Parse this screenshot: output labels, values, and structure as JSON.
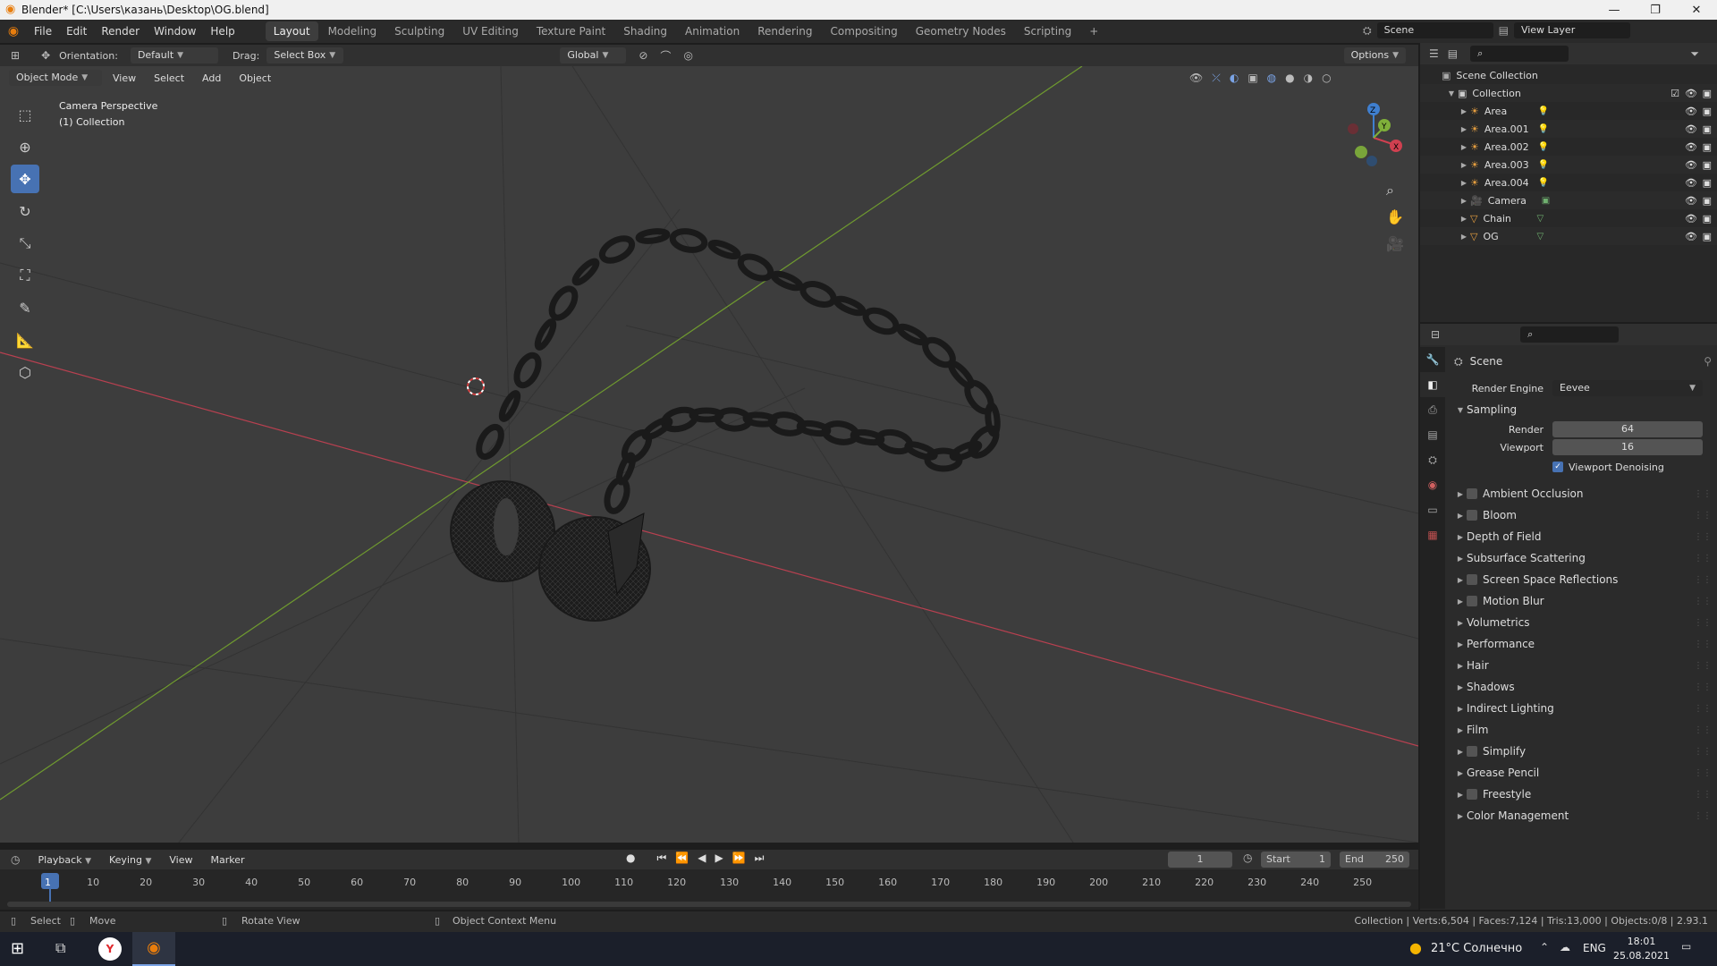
{
  "window": {
    "title": "Blender* [C:\\Users\\казань\\Desktop\\OG.blend]"
  },
  "menu": [
    "File",
    "Edit",
    "Render",
    "Window",
    "Help"
  ],
  "workspaces": [
    "Layout",
    "Modeling",
    "Sculpting",
    "UV Editing",
    "Texture Paint",
    "Shading",
    "Animation",
    "Rendering",
    "Compositing",
    "Geometry Nodes",
    "Scripting",
    "+"
  ],
  "scene_name": "Scene",
  "view_layer": "View Layer",
  "header": {
    "orientation_label": "Orientation:",
    "orientation_value": "Default",
    "drag_label": "Drag:",
    "drag_value": "Select Box",
    "transform_space": "Global",
    "options": "Options"
  },
  "viewport_header": {
    "mode": "Object Mode",
    "view": "View",
    "select": "Select",
    "add": "Add",
    "object": "Object"
  },
  "viewport": {
    "camera_label": "Camera Perspective",
    "collection_label": "(1) Collection"
  },
  "outliner": {
    "root": "Scene Collection",
    "collection": "Collection",
    "items": [
      {
        "name": "Area",
        "type": "light"
      },
      {
        "name": "Area.001",
        "type": "light"
      },
      {
        "name": "Area.002",
        "type": "light"
      },
      {
        "name": "Area.003",
        "type": "light"
      },
      {
        "name": "Area.004",
        "type": "light"
      },
      {
        "name": "Camera",
        "type": "camera"
      },
      {
        "name": "Chain",
        "type": "mesh"
      },
      {
        "name": "OG",
        "type": "mesh"
      }
    ]
  },
  "properties": {
    "context": "Scene",
    "render_engine_label": "Render Engine",
    "render_engine": "Eevee",
    "sampling": "Sampling",
    "render_label": "Render",
    "render_value": "64",
    "viewport_label": "Viewport",
    "viewport_value": "16",
    "viewport_denoising": "Viewport Denoising",
    "panels": [
      {
        "label": "Ambient Occlusion",
        "checkbox": true
      },
      {
        "label": "Bloom",
        "checkbox": true
      },
      {
        "label": "Depth of Field",
        "checkbox": false
      },
      {
        "label": "Subsurface Scattering",
        "checkbox": false
      },
      {
        "label": "Screen Space Reflections",
        "checkbox": true
      },
      {
        "label": "Motion Blur",
        "checkbox": true
      },
      {
        "label": "Volumetrics",
        "checkbox": false
      },
      {
        "label": "Performance",
        "checkbox": false
      },
      {
        "label": "Hair",
        "checkbox": false
      },
      {
        "label": "Shadows",
        "checkbox": false
      },
      {
        "label": "Indirect Lighting",
        "checkbox": false
      },
      {
        "label": "Film",
        "checkbox": false
      },
      {
        "label": "Simplify",
        "checkbox": true
      },
      {
        "label": "Grease Pencil",
        "checkbox": false
      },
      {
        "label": "Freestyle",
        "checkbox": true
      },
      {
        "label": "Color Management",
        "checkbox": false
      }
    ]
  },
  "timeline": {
    "playback": "Playback",
    "keying": "Keying",
    "view": "View",
    "marker": "Marker",
    "current_frame": "1",
    "start_label": "Start",
    "start": "1",
    "end_label": "End",
    "end": "250",
    "ticks": [
      "1",
      "10",
      "20",
      "30",
      "40",
      "50",
      "60",
      "70",
      "80",
      "90",
      "100",
      "110",
      "120",
      "130",
      "140",
      "150",
      "160",
      "170",
      "180",
      "190",
      "200",
      "210",
      "220",
      "230",
      "240",
      "250"
    ]
  },
  "statusbar": {
    "select": "Select",
    "move": "Move",
    "rotate": "Rotate View",
    "context": "Object Context Menu",
    "stats": "Collection | Verts:6,504 | Faces:7,124 | Tris:13,000 | Objects:0/8 | 2.93.1"
  },
  "taskbar": {
    "weather": "21°C Солнечно",
    "lang": "ENG",
    "time": "18:01",
    "date": "25.08.2021"
  },
  "colors": {
    "accent": "#4772b3",
    "x_axis": "#c0464f",
    "y_axis": "#7ea33a"
  }
}
